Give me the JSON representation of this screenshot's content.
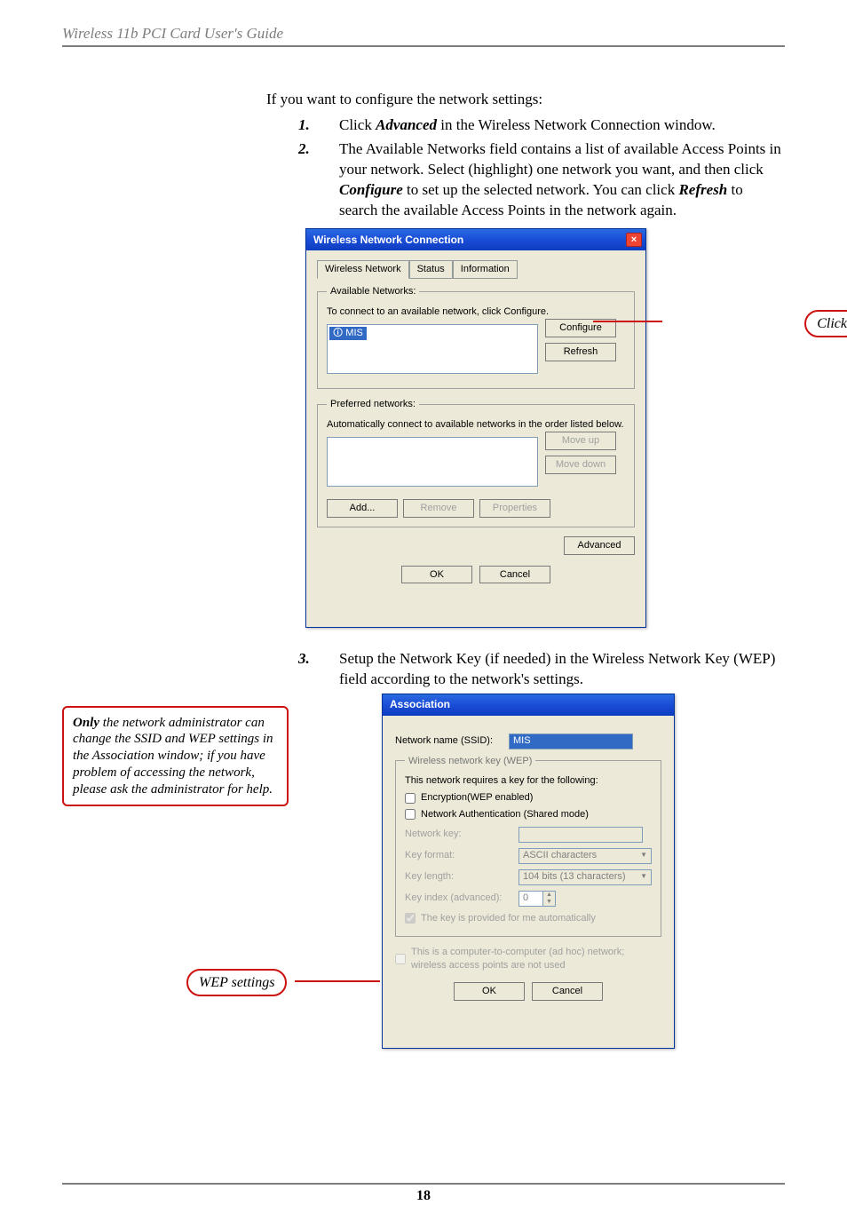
{
  "header": "Wireless 11b PCI Card User's Guide",
  "intro": "If you want to configure the network settings:",
  "steps": [
    {
      "num": "1.",
      "parts": [
        "Click ",
        "Advanced",
        " in the Wireless Network Connection window."
      ]
    },
    {
      "num": "2.",
      "parts": [
        "The Available Networks field contains a list of available Access Points in your network. Select (highlight) one network you want, and then click ",
        "Configure",
        " to set up the selected network.  You can click ",
        "Refresh",
        " to search the available Access Points in the network again."
      ]
    },
    {
      "num": "3.",
      "parts": [
        "Setup the Network Key (if needed) in the Wireless Network Key (WEP) field according to the network's settings."
      ]
    }
  ],
  "click_label": "Click",
  "admin_note_parts": [
    "Only",
    " the network administrator can change the SSID and WEP settings in the Association window; if you have problem of accessing the network, please ask the administrator for help."
  ],
  "wep_tag": "WEP settings",
  "page_num": "18",
  "win1": {
    "title": "Wireless Network Connection",
    "tabs": [
      "Wireless Network",
      "Status",
      "Information"
    ],
    "grp1": {
      "legend": "Available Networks:",
      "helper": "To connect to an available network, click Configure.",
      "item": "MIS",
      "configure": "Configure",
      "refresh": "Refresh"
    },
    "grp2": {
      "legend": "Preferred networks:",
      "helper": "Automatically connect to available networks in the order listed below.",
      "moveup": "Move up",
      "movedown": "Move down",
      "add": "Add...",
      "remove": "Remove",
      "properties": "Properties"
    },
    "advanced": "Advanced",
    "ok": "OK",
    "cancel": "Cancel"
  },
  "win2": {
    "title": "Association",
    "ssid_label": "Network name (SSID):",
    "ssid_value": "MIS",
    "wep_legend": "Wireless network key (WEP)",
    "req": "This network requires a key for the following:",
    "enc": "Encryption(WEP enabled)",
    "auth": "Network Authentication (Shared mode)",
    "key_label": "Network key:",
    "fmt_label": "Key format:",
    "fmt_value": "ASCII characters",
    "len_label": "Key length:",
    "len_value": "104 bits (13 characters)",
    "idx_label": "Key index (advanced):",
    "idx_value": "0",
    "auto": "The key is provided for me automatically",
    "adhoc": "This is a computer-to-computer (ad hoc) network; wireless access points are not used",
    "ok": "OK",
    "cancel": "Cancel"
  }
}
